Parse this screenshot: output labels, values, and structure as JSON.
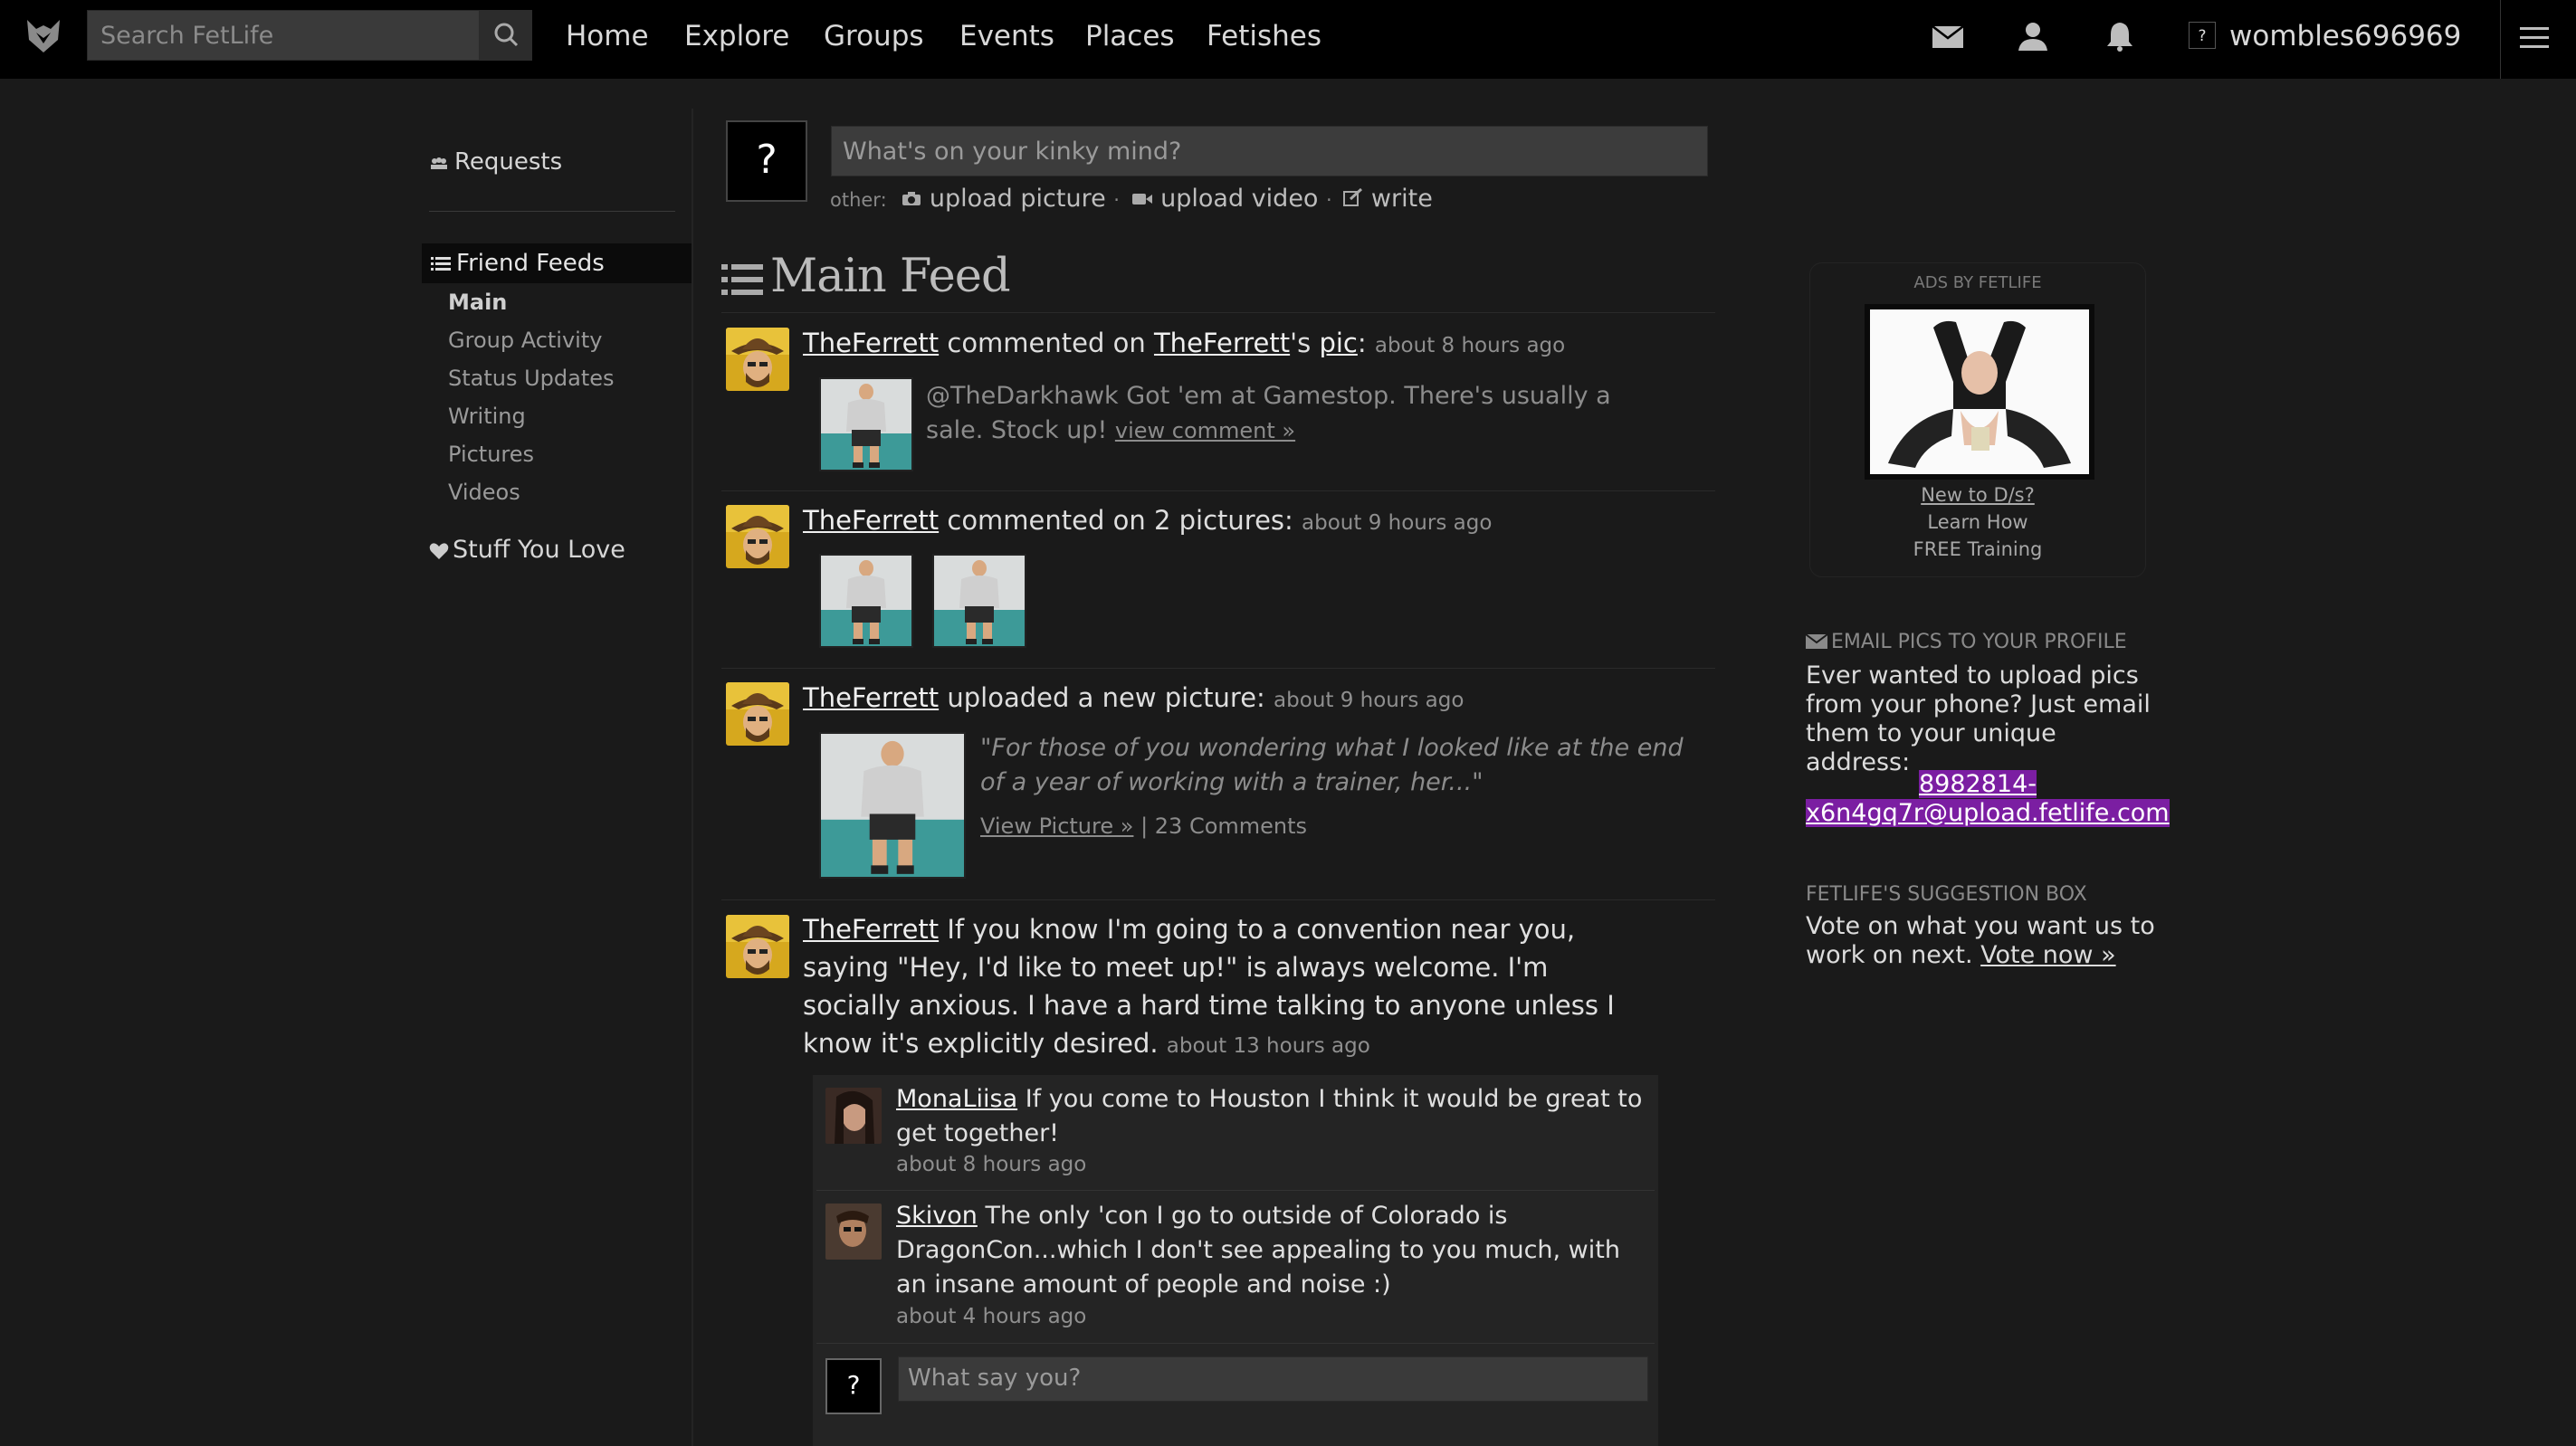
{
  "topbar": {
    "search_placeholder": "Search FetLife",
    "nav": [
      "Home",
      "Explore",
      "Groups",
      "Events",
      "Places",
      "Fetishes"
    ],
    "avatar_glyph": "?",
    "username": "wombles696969",
    "icons": [
      "envelope-icon",
      "person-icon",
      "bell-icon",
      "hamburger-menu-icon"
    ]
  },
  "sidebar": {
    "requests": "Requests",
    "friend_feeds": "Friend Feeds",
    "items": [
      "Main",
      "Group Activity",
      "Status Updates",
      "Writing",
      "Pictures",
      "Videos"
    ],
    "stuff_you_love": "Stuff You Love"
  },
  "composer": {
    "avatar_glyph": "?",
    "placeholder": "What's on your kinky mind?",
    "other_label": "other:",
    "upload_picture": "upload picture",
    "upload_video": "upload video",
    "write": "write",
    "dot": "·"
  },
  "feed": {
    "title": "Main Feed",
    "entries": [
      {
        "user": "TheFerrett",
        "action": " commented on ",
        "target_user": "TheFerrett",
        "possessive": "'s ",
        "target": "pic",
        "colon": ":",
        "time": "about 8 hours ago",
        "comment": "@TheDarkhawk Got 'em at Gamestop. There's usually a sale. Stock up!",
        "comment_link": "view comment »"
      },
      {
        "user": "TheFerrett",
        "action": " commented on 2 pictures:",
        "time": "about 9 hours ago"
      },
      {
        "user": "TheFerrett",
        "action": " uploaded a new picture:",
        "time": "about 9 hours ago",
        "quote": "\"For those of you wondering what I looked like at the end of a year of working with a trainer, her...\"",
        "view_link": "View Picture »",
        "separator": " | ",
        "comments": "23 Comments"
      },
      {
        "user": "TheFerrett",
        "status": " If you know I'm going to a convention near you, saying \"Hey, I'd like to meet up!\" is always welcome. I'm socially anxious. I have a hard time talking to anyone unless I know it's explicitly desired.",
        "time": "about 13 hours ago",
        "replies": [
          {
            "user": "MonaLiisa",
            "text": " If you come to Houston I think it would be great to get together!",
            "time": "about 8 hours ago"
          },
          {
            "user": "Skivon",
            "text": " The only 'con I go to outside of Colorado is DragonCon...which I don't see appealing to you much, with an insane amount of people and noise :)",
            "time": "about 4 hours ago"
          }
        ],
        "reply_avatar_glyph": "?",
        "reply_placeholder": "What say you?"
      }
    ]
  },
  "right": {
    "ad_label": "ADS BY FETLIFE",
    "ad_link": "New to D/s?",
    "ad_line2": "Learn How",
    "ad_line3": "FREE Training",
    "email_head": "EMAIL PICS TO YOUR PROFILE",
    "email_text": "Ever wanted to upload pics from your phone? Just email them to your unique address:",
    "email_line1": "8982814-",
    "email_line2": "x6n4gq7r@upload.fetlife.com",
    "suggest_head": "FETLIFE'S SUGGESTION BOX",
    "suggest_text": "Vote on what you want us to work on next.",
    "suggest_link": "Vote now »"
  },
  "colors": {
    "background": "#1a1a1a",
    "topbar": "#000000",
    "email_highlight": "#7b1ea2"
  }
}
